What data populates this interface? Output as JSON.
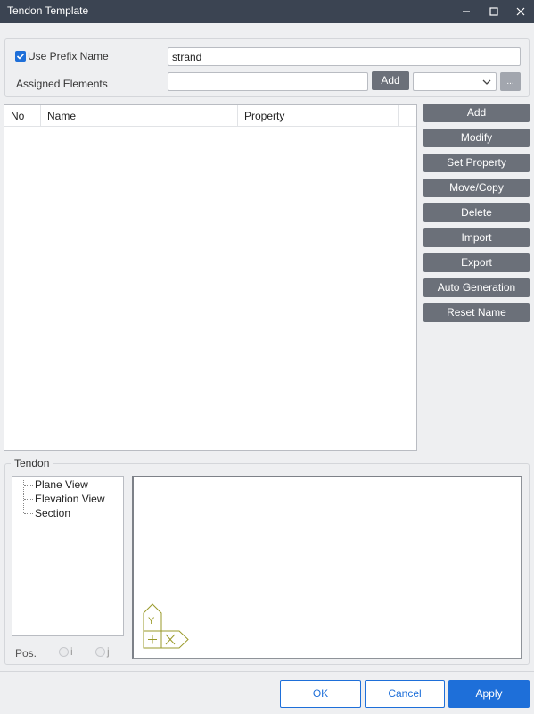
{
  "window": {
    "title": "Tendon Template"
  },
  "prefix": {
    "use_prefix_label": "Use Prefix Name",
    "use_prefix_checked": true,
    "prefix_value": "strand",
    "assigned_label": "Assigned Elements",
    "assigned_value": "",
    "add_label": "Add",
    "dropdown_value": "",
    "browse_label": "..."
  },
  "table": {
    "columns": [
      "No",
      "Name",
      "Property"
    ],
    "rows": []
  },
  "side_buttons": [
    "Add",
    "Modify",
    "Set Property",
    "Move/Copy",
    "Delete",
    "Import",
    "Export",
    "Auto Generation",
    "Reset Name"
  ],
  "tendon": {
    "group_label": "Tendon",
    "tree_items": [
      "Plane View",
      "Elevation View",
      "Section"
    ],
    "pos_label": "Pos.",
    "radio_i": "i",
    "radio_j": "j",
    "axis_y": "Y"
  },
  "footer": {
    "ok": "OK",
    "cancel": "Cancel",
    "apply": "Apply"
  },
  "colors": {
    "titlebar": "#3b4452",
    "accent": "#1e6fd9",
    "button_dark": "#6b7079",
    "axis": "#9a9a2a"
  },
  "icons": [
    "minimize-icon",
    "maximize-icon",
    "close-icon",
    "check-icon",
    "chevron-down-icon"
  ]
}
